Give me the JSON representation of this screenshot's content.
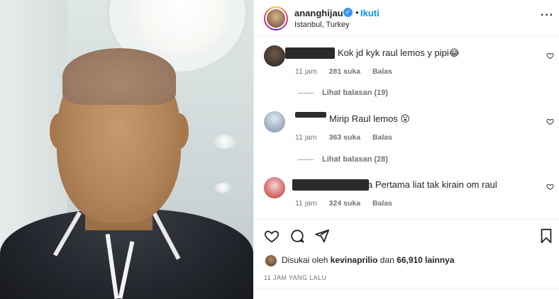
{
  "post": {
    "username": "ananghijau",
    "follow_label": "Ikuti",
    "separator": "•",
    "location": "Istanbul, Turkey",
    "more_label": "···",
    "verified_mark": "✓"
  },
  "comments": [
    {
      "text": "Kok jd kyk raul lemos y pipi😂",
      "time": "11 jam",
      "likes": "281 suka",
      "reply": "Balas",
      "view_replies": "Lihat balasan (19)"
    },
    {
      "text": "Mirip Raul lemos 😮",
      "time": "11 jam",
      "likes": "363 suka",
      "reply": "Balas",
      "view_replies": "Lihat balasan (28)"
    },
    {
      "text": "a Pertama liat tak kirain om raul",
      "time": "11 jam",
      "likes": "324 suka",
      "reply": "Balas"
    }
  ],
  "likes": {
    "prefix": "Disukai oleh",
    "user": "kevinaprilio",
    "connector": "dan",
    "others": "66,910 lainnya"
  },
  "timestamp": "11 JAM YANG LALU",
  "icons": {
    "like": "heart-icon",
    "comment": "comment-icon",
    "share": "share-icon",
    "save": "bookmark-icon",
    "more": "more-icon"
  },
  "colors": {
    "accent": "#0095f6",
    "verified": "#3897f0",
    "text": "#262626",
    "muted": "#737373"
  }
}
